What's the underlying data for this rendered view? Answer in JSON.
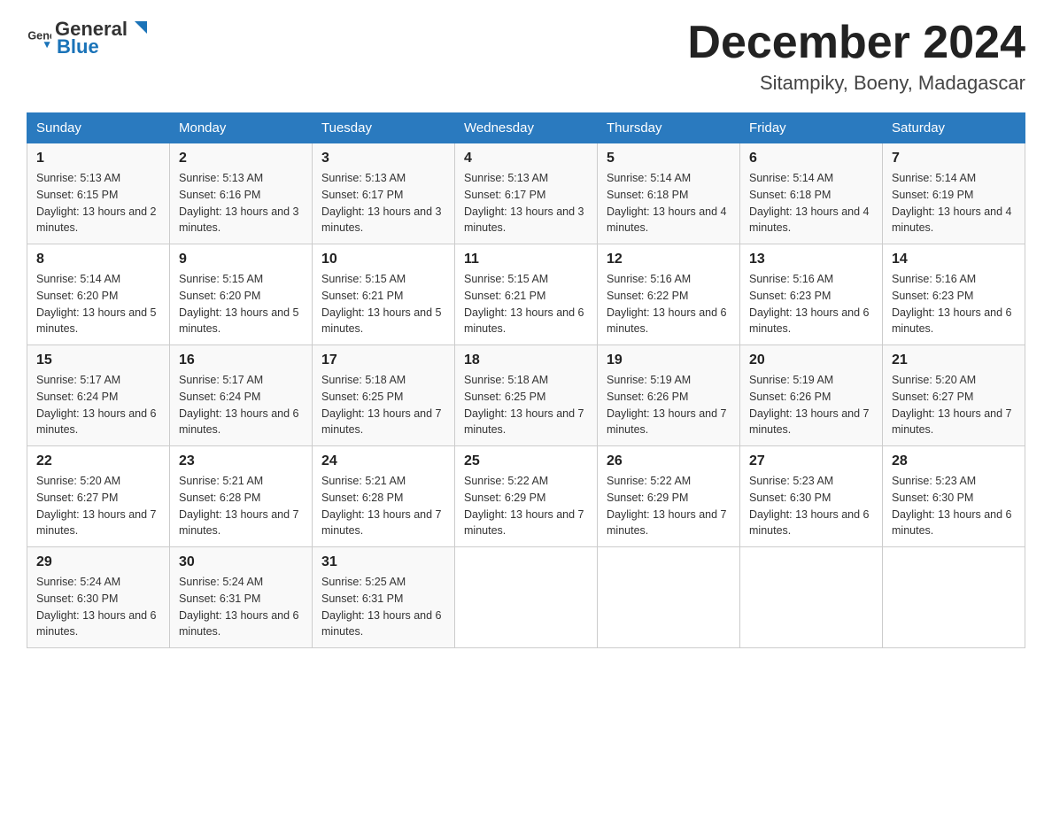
{
  "header": {
    "logo_general": "General",
    "logo_blue": "Blue",
    "month_year": "December 2024",
    "location": "Sitampiky, Boeny, Madagascar"
  },
  "days_of_week": [
    "Sunday",
    "Monday",
    "Tuesday",
    "Wednesday",
    "Thursday",
    "Friday",
    "Saturday"
  ],
  "weeks": [
    [
      {
        "day": "1",
        "sunrise": "5:13 AM",
        "sunset": "6:15 PM",
        "daylight": "13 hours and 2 minutes."
      },
      {
        "day": "2",
        "sunrise": "5:13 AM",
        "sunset": "6:16 PM",
        "daylight": "13 hours and 3 minutes."
      },
      {
        "day": "3",
        "sunrise": "5:13 AM",
        "sunset": "6:17 PM",
        "daylight": "13 hours and 3 minutes."
      },
      {
        "day": "4",
        "sunrise": "5:13 AM",
        "sunset": "6:17 PM",
        "daylight": "13 hours and 3 minutes."
      },
      {
        "day": "5",
        "sunrise": "5:14 AM",
        "sunset": "6:18 PM",
        "daylight": "13 hours and 4 minutes."
      },
      {
        "day": "6",
        "sunrise": "5:14 AM",
        "sunset": "6:18 PM",
        "daylight": "13 hours and 4 minutes."
      },
      {
        "day": "7",
        "sunrise": "5:14 AM",
        "sunset": "6:19 PM",
        "daylight": "13 hours and 4 minutes."
      }
    ],
    [
      {
        "day": "8",
        "sunrise": "5:14 AM",
        "sunset": "6:20 PM",
        "daylight": "13 hours and 5 minutes."
      },
      {
        "day": "9",
        "sunrise": "5:15 AM",
        "sunset": "6:20 PM",
        "daylight": "13 hours and 5 minutes."
      },
      {
        "day": "10",
        "sunrise": "5:15 AM",
        "sunset": "6:21 PM",
        "daylight": "13 hours and 5 minutes."
      },
      {
        "day": "11",
        "sunrise": "5:15 AM",
        "sunset": "6:21 PM",
        "daylight": "13 hours and 6 minutes."
      },
      {
        "day": "12",
        "sunrise": "5:16 AM",
        "sunset": "6:22 PM",
        "daylight": "13 hours and 6 minutes."
      },
      {
        "day": "13",
        "sunrise": "5:16 AM",
        "sunset": "6:23 PM",
        "daylight": "13 hours and 6 minutes."
      },
      {
        "day": "14",
        "sunrise": "5:16 AM",
        "sunset": "6:23 PM",
        "daylight": "13 hours and 6 minutes."
      }
    ],
    [
      {
        "day": "15",
        "sunrise": "5:17 AM",
        "sunset": "6:24 PM",
        "daylight": "13 hours and 6 minutes."
      },
      {
        "day": "16",
        "sunrise": "5:17 AM",
        "sunset": "6:24 PM",
        "daylight": "13 hours and 6 minutes."
      },
      {
        "day": "17",
        "sunrise": "5:18 AM",
        "sunset": "6:25 PM",
        "daylight": "13 hours and 7 minutes."
      },
      {
        "day": "18",
        "sunrise": "5:18 AM",
        "sunset": "6:25 PM",
        "daylight": "13 hours and 7 minutes."
      },
      {
        "day": "19",
        "sunrise": "5:19 AM",
        "sunset": "6:26 PM",
        "daylight": "13 hours and 7 minutes."
      },
      {
        "day": "20",
        "sunrise": "5:19 AM",
        "sunset": "6:26 PM",
        "daylight": "13 hours and 7 minutes."
      },
      {
        "day": "21",
        "sunrise": "5:20 AM",
        "sunset": "6:27 PM",
        "daylight": "13 hours and 7 minutes."
      }
    ],
    [
      {
        "day": "22",
        "sunrise": "5:20 AM",
        "sunset": "6:27 PM",
        "daylight": "13 hours and 7 minutes."
      },
      {
        "day": "23",
        "sunrise": "5:21 AM",
        "sunset": "6:28 PM",
        "daylight": "13 hours and 7 minutes."
      },
      {
        "day": "24",
        "sunrise": "5:21 AM",
        "sunset": "6:28 PM",
        "daylight": "13 hours and 7 minutes."
      },
      {
        "day": "25",
        "sunrise": "5:22 AM",
        "sunset": "6:29 PM",
        "daylight": "13 hours and 7 minutes."
      },
      {
        "day": "26",
        "sunrise": "5:22 AM",
        "sunset": "6:29 PM",
        "daylight": "13 hours and 7 minutes."
      },
      {
        "day": "27",
        "sunrise": "5:23 AM",
        "sunset": "6:30 PM",
        "daylight": "13 hours and 6 minutes."
      },
      {
        "day": "28",
        "sunrise": "5:23 AM",
        "sunset": "6:30 PM",
        "daylight": "13 hours and 6 minutes."
      }
    ],
    [
      {
        "day": "29",
        "sunrise": "5:24 AM",
        "sunset": "6:30 PM",
        "daylight": "13 hours and 6 minutes."
      },
      {
        "day": "30",
        "sunrise": "5:24 AM",
        "sunset": "6:31 PM",
        "daylight": "13 hours and 6 minutes."
      },
      {
        "day": "31",
        "sunrise": "5:25 AM",
        "sunset": "6:31 PM",
        "daylight": "13 hours and 6 minutes."
      },
      null,
      null,
      null,
      null
    ]
  ]
}
